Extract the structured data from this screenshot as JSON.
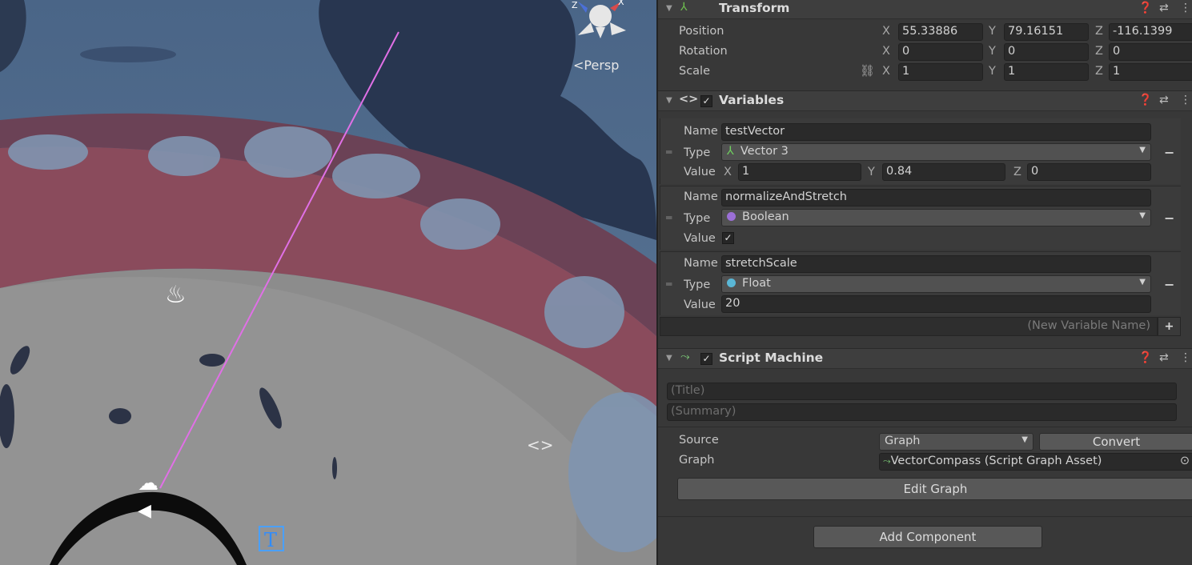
{
  "scene": {
    "view_mode": "Persp",
    "gizmo_axes": [
      "Z",
      "X"
    ]
  },
  "transform": {
    "title": "Transform",
    "position": {
      "label": "Position",
      "x": "55.33886",
      "y": "79.16151",
      "z": "-116.1399"
    },
    "rotation": {
      "label": "Rotation",
      "x": "0",
      "y": "0",
      "z": "0"
    },
    "scale": {
      "label": "Scale",
      "x": "1",
      "y": "1",
      "z": "1"
    },
    "axes": {
      "x": "X",
      "y": "Y",
      "z": "Z"
    }
  },
  "variables": {
    "title": "Variables",
    "labels": {
      "name": "Name",
      "type": "Type",
      "value": "Value"
    },
    "items": [
      {
        "name": "testVector",
        "type": "Vector 3",
        "value_x": "1",
        "value_y": "0.84",
        "value_z": "0"
      },
      {
        "name": "normalizeAndStretch",
        "type": "Boolean",
        "value": "✓",
        "dot_color": "#9b6fd6"
      },
      {
        "name": "stretchScale",
        "type": "Float",
        "value": "20",
        "dot_color": "#5ab7d6"
      }
    ],
    "new_placeholder": "(New Variable Name)",
    "add_label": "+"
  },
  "script_machine": {
    "title": "Script Machine",
    "title_placeholder": "(Title)",
    "summary_placeholder": "(Summary)",
    "source_label": "Source",
    "source_value": "Graph",
    "convert_label": "Convert",
    "graph_label": "Graph",
    "graph_value": "VectorCompass (Script Graph Asset)",
    "edit_graph_label": "Edit Graph"
  },
  "add_component_label": "Add Component"
}
